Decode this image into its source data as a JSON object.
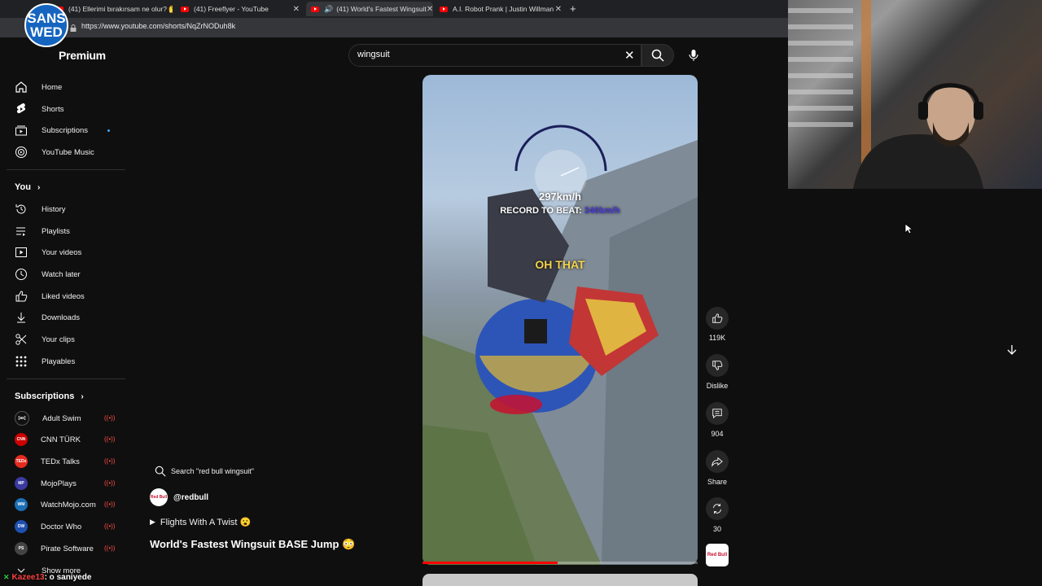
{
  "browser": {
    "tabs": [
      {
        "title": "(41) Ellerimi bırakırsam ne olur? 🤔"
      },
      {
        "title": "(41) Freeflyer - YouTube"
      },
      {
        "title": "(41) World's Fastest Wingsuit"
      },
      {
        "title": "A.I. Robot Prank | Justin Willman"
      }
    ],
    "url": "https://www.youtube.com/shorts/NqZrNODuh8k"
  },
  "overlay_logo": {
    "line1": "SANS",
    "line2": "WED"
  },
  "header": {
    "brand": "Premium",
    "search_value": "wingsuit"
  },
  "sidebar": {
    "main": [
      {
        "label": "Home",
        "icon": "home-icon"
      },
      {
        "label": "Shorts",
        "icon": "shorts-icon"
      },
      {
        "label": "Subscriptions",
        "icon": "subscriptions-icon"
      },
      {
        "label": "YouTube Music",
        "icon": "music-icon"
      }
    ],
    "you_heading": "You",
    "you": [
      {
        "label": "History",
        "icon": "history-icon"
      },
      {
        "label": "Playlists",
        "icon": "playlists-icon"
      },
      {
        "label": "Your videos",
        "icon": "your-videos-icon"
      },
      {
        "label": "Watch later",
        "icon": "clock-icon"
      },
      {
        "label": "Liked videos",
        "icon": "thumbs-up-icon"
      },
      {
        "label": "Downloads",
        "icon": "download-icon"
      },
      {
        "label": "Your clips",
        "icon": "scissors-icon"
      },
      {
        "label": "Playables",
        "icon": "playables-icon"
      }
    ],
    "subscriptions_heading": "Subscriptions",
    "subscriptions": [
      {
        "label": "Adult Swim",
        "avatar_text": "[as]",
        "color": "#111111"
      },
      {
        "label": "CNN TÜRK",
        "avatar_text": "CNN",
        "color": "#cc0000"
      },
      {
        "label": "TEDx Talks",
        "avatar_text": "TEDx",
        "color": "#e62b1e"
      },
      {
        "label": "MojoPlays",
        "avatar_text": "MP",
        "color": "#3a3aa0"
      },
      {
        "label": "WatchMojo.com",
        "avatar_text": "WM",
        "color": "#1a6fb5"
      },
      {
        "label": "Doctor Who",
        "avatar_text": "DW",
        "color": "#1f4fb0"
      },
      {
        "label": "Pirate Software",
        "avatar_text": "PS",
        "color": "#444444"
      }
    ],
    "show_more": "Show more"
  },
  "short": {
    "overlay_speed": "297km/h",
    "overlay_record_label": "RECORD TO BEAT:",
    "overlay_record_value": "340km/h",
    "overlay_caption": "OH THAT",
    "progress_fraction": 0.49,
    "search_suggestion": "Search \"red bull wingsuit\"",
    "channel": "@redbull",
    "channel_avatar_text": "Red Bull",
    "playlist": "Flights With A Twist 😮",
    "title": "World's Fastest Wingsuit BASE Jump 😳"
  },
  "actions": {
    "likes": "119K",
    "dislike": "Dislike",
    "comments": "904",
    "share": "Share",
    "remix": "30"
  },
  "chat": {
    "user": "Kazee13",
    "message": ": o saniyede"
  }
}
